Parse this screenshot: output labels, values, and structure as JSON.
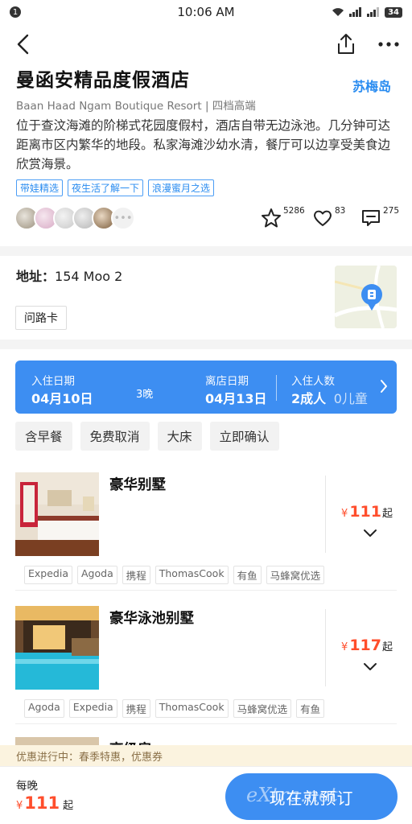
{
  "status_bar": {
    "notification_count": "1",
    "time": "10:06 AM",
    "battery": "34"
  },
  "hotel": {
    "name": "曼函安精品度假酒店",
    "english_name": "Baan Haad Ngam Boutique Resort | 四档高端",
    "city": "苏梅岛",
    "description": "位于查汶海滩的阶梯式花园度假村，酒店自带无边泳池。几分钟可达距离市区内繁华的地段。私家海滩沙幼水清，餐厅可以边享受美食边欣赏海景。",
    "tags": [
      "带娃精选",
      "夜生活了解一下",
      "浪漫蜜月之选"
    ]
  },
  "social": {
    "more_avatars": "•••",
    "favorites": "5286",
    "likes": "83",
    "comments": "275"
  },
  "address": {
    "label": "地址：",
    "value": "154 Moo 2",
    "route_card": "问路卡"
  },
  "booking": {
    "checkin_label": "入住日期",
    "checkin_date": "04月10日",
    "nights": "3晚",
    "checkout_label": "离店日期",
    "checkout_date": "04月13日",
    "guests_label": "入住人数",
    "adults": "2成人",
    "children": "0儿童"
  },
  "filters": [
    "含早餐",
    "免费取消",
    "大床",
    "立即确认"
  ],
  "rooms": [
    {
      "name": "豪华别墅",
      "currency": "¥",
      "price": "111",
      "suffix": "起",
      "sources": [
        "Expedia",
        "Agoda",
        "携程",
        "ThomasCook",
        "有鱼",
        "马蜂窝优选"
      ]
    },
    {
      "name": "豪华泳池别墅",
      "currency": "¥",
      "price": "117",
      "suffix": "起",
      "sources": [
        "Agoda",
        "Expedia",
        "携程",
        "ThomasCook",
        "马蜂窝优选",
        "有鱼"
      ]
    },
    {
      "name": "高级房"
    }
  ],
  "promo": "优惠进行中：春季特惠，优惠券",
  "bottom_bar": {
    "per_night": "每晚",
    "currency": "¥",
    "price": "111",
    "suffix": "起",
    "book_label": "现在就预订"
  },
  "watermark": "eXtra.net",
  "colors": {
    "accent": "#3d8ef2",
    "price": "#ff4e2c",
    "promo_bg": "#fbf3df"
  }
}
